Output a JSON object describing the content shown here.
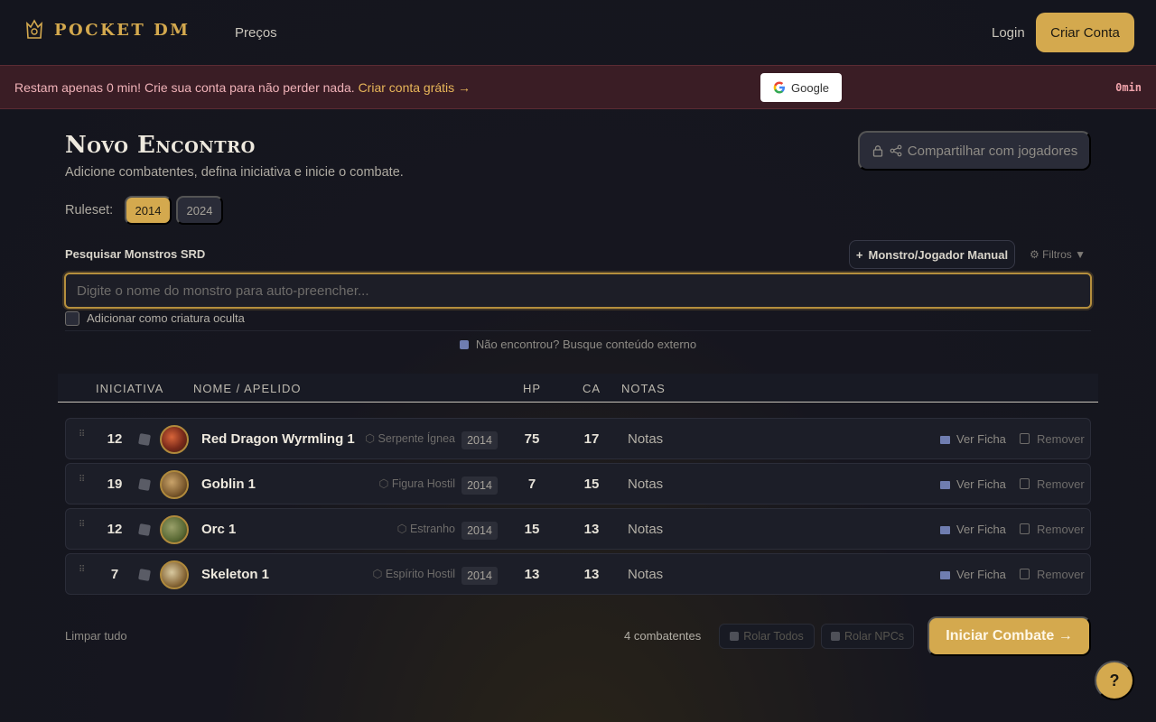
{
  "header": {
    "logo_text": "POCKET DM",
    "nav_precos": "Preços",
    "nav_login": "Login",
    "criar_conta": "Criar Conta"
  },
  "banner": {
    "text": "Restam apenas 0 min! Crie sua conta para não perder nada.",
    "link": "Criar conta grátis →",
    "google": "Google",
    "timer": "0min"
  },
  "page": {
    "title": "Novo Encontro",
    "subtitle": "Adicione combatentes, defina iniciativa e inicie o combate.",
    "share_button": "Compartilhar com jogadores",
    "ruleset_label": "Ruleset:",
    "ruleset_options": [
      "2014",
      "2024"
    ],
    "ruleset_selected": "2014"
  },
  "search": {
    "label": "Pesquisar Monstros SRD",
    "manual_button": "Monstro/Jogador Manual",
    "filtros": "⚙ Filtros ▼",
    "placeholder": "Digite o nome do monstro para auto-preencher...",
    "hidden_label": "Adicionar como criatura oculta",
    "external_text": "Não encontrou? Busque conteúdo externo"
  },
  "table": {
    "columns": [
      "INICIATIVA",
      "NOME / APELIDO",
      "HP",
      "CA",
      "NOTAS"
    ],
    "rows": [
      {
        "initiative": "12",
        "name": "Red Dragon Wyrmling 1",
        "type": "Serpente Ígnea",
        "year": "2014",
        "hp": "75",
        "ca": "17",
        "notes": "Notas",
        "ver_ficha": "Ver Ficha",
        "remover": "Remover"
      },
      {
        "initiative": "19",
        "name": "Goblin 1",
        "type": "Figura Hostil",
        "year": "2014",
        "hp": "7",
        "ca": "15",
        "notes": "Notas",
        "ver_ficha": "Ver Ficha",
        "remover": "Remover"
      },
      {
        "initiative": "12",
        "name": "Orc 1",
        "type": "Estranho",
        "year": "2014",
        "hp": "15",
        "ca": "13",
        "notes": "Notas",
        "ver_ficha": "Ver Ficha",
        "remover": "Remover"
      },
      {
        "initiative": "7",
        "name": "Skeleton 1",
        "type": "Espírito Hostil",
        "year": "2014",
        "hp": "13",
        "ca": "13",
        "notes": "Notas",
        "ver_ficha": "Ver Ficha",
        "remover": "Remover"
      }
    ]
  },
  "footer": {
    "limpar": "Limpar tudo",
    "count": "4 combatentes",
    "rolar_todos": "Rolar Todos",
    "rolar_npcs": "Rolar NPCs",
    "iniciar": "Iniciar Combate →",
    "help": "?"
  },
  "colors": {
    "accent": "#d4a94e",
    "banner_bg": "#3a1d25",
    "background": "#16161f"
  }
}
